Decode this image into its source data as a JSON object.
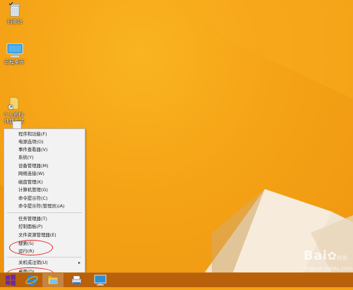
{
  "desktop": {
    "icons": [
      {
        "label": "回收站",
        "icon": "recycle-bin-icon"
      },
      {
        "label": "远程桌面",
        "icon": "computer-monitor-icon"
      },
      {
        "label": "个人资料-\n快捷方式",
        "icon": "folder-shortcut-icon"
      }
    ]
  },
  "winx_menu": {
    "items": [
      {
        "label": "程序和功能(F)"
      },
      {
        "label": "电源选项(O)"
      },
      {
        "label": "事件查看器(V)"
      },
      {
        "label": "系统(Y)"
      },
      {
        "label": "设备管理器(M)"
      },
      {
        "label": "网络连接(W)"
      },
      {
        "label": "磁盘管理(K)"
      },
      {
        "label": "计算机管理(G)"
      },
      {
        "label": "命令提示符(C)"
      },
      {
        "label": "命令提示符(管理员)(A)"
      },
      {
        "label": "任务管理器(T)"
      },
      {
        "label": "控制面板(P)"
      },
      {
        "label": "文件资源管理器(E)"
      },
      {
        "label": "搜索(S)"
      },
      {
        "label": "运行(R)"
      },
      {
        "label": "关机或注销(U)",
        "submenu": "▸"
      },
      {
        "label": "桌面(D)"
      }
    ]
  },
  "taskbar": {
    "buttons": [
      {
        "name": "start-button",
        "icon": "windows-logo-icon"
      },
      {
        "name": "internet-explorer",
        "icon": "internet-explorer-icon"
      },
      {
        "name": "file-explorer",
        "icon": "folder-icon"
      },
      {
        "name": "app-3",
        "icon": "printer-icon"
      },
      {
        "name": "app-4",
        "icon": "remote-desktop-icon"
      }
    ]
  },
  "watermark": {
    "brand": "Bai",
    "brand2": "经验",
    "url": "jingyan.baidu.com"
  },
  "colors": {
    "desktop": "#f5a316",
    "taskbar": "#b8600a",
    "menu_bg": "#f2f2f2",
    "annotation": "#e02424"
  }
}
